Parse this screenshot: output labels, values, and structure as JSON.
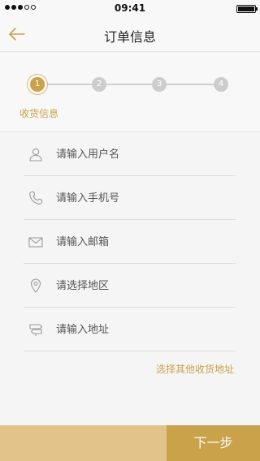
{
  "status_bar": {
    "time": "09:41",
    "signal_bars_filled": 3,
    "signal_bars_total": 5,
    "battery_level": 1.0
  },
  "nav": {
    "title": "订单信息",
    "back_icon": "arrow-left-icon",
    "accent_color": "#c9a24a"
  },
  "stepper": {
    "steps": [
      "1",
      "2",
      "3",
      "4"
    ],
    "active_step": 1,
    "active_label": "收货信息"
  },
  "form": {
    "fields": [
      {
        "icon": "user-icon",
        "placeholder": "请输入用户名"
      },
      {
        "icon": "phone-icon",
        "placeholder": "请输入手机号"
      },
      {
        "icon": "mail-icon",
        "placeholder": "请输入邮箱"
      },
      {
        "icon": "location-pin-icon",
        "placeholder": "请选择地区"
      },
      {
        "icon": "signpost-icon",
        "placeholder": "请输入地址"
      }
    ],
    "other_address_link": "选择其他收货地址"
  },
  "footer": {
    "next_button": "下一步",
    "bar_color": "#e2c48a",
    "button_color": "#c9a24a"
  }
}
